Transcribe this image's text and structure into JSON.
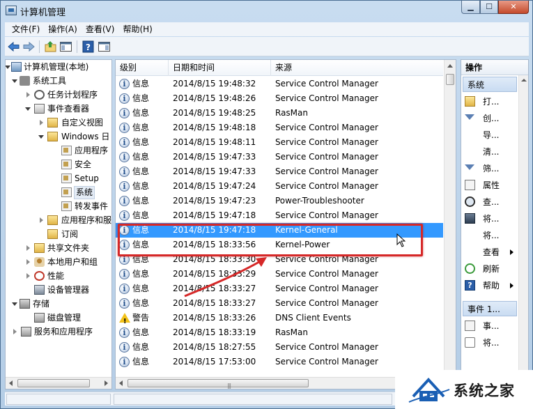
{
  "window": {
    "title": "计算机管理",
    "controls": {
      "minimize": "▁",
      "maximize": "☐",
      "close": "✕"
    }
  },
  "menu": [
    "文件(F)",
    "操作(A)",
    "查看(V)",
    "帮助(H)"
  ],
  "toolbar": {
    "icons": [
      "back-arrow-icon",
      "forward-arrow-icon",
      "up-folder-icon",
      "show-hide-tree-icon",
      "help-icon",
      "show-hide-action-pane-icon"
    ]
  },
  "tree": [
    {
      "label": "计算机管理(本地)",
      "level": 0,
      "expanded": true,
      "icon": "computer-management-icon"
    },
    {
      "label": "系统工具",
      "level": 1,
      "expanded": true,
      "icon": "system-tools-icon"
    },
    {
      "label": "任务计划程序",
      "level": 2,
      "expanded": false,
      "icon": "task-scheduler-icon"
    },
    {
      "label": "事件查看器",
      "level": 2,
      "expanded": true,
      "icon": "event-viewer-icon"
    },
    {
      "label": "自定义视图",
      "level": 3,
      "expanded": false,
      "icon": "folder-icon"
    },
    {
      "label": "Windows 日",
      "level": 3,
      "expanded": true,
      "icon": "folder-icon"
    },
    {
      "label": "应用程序",
      "level": 4,
      "icon": "log-icon"
    },
    {
      "label": "安全",
      "level": 4,
      "icon": "log-icon"
    },
    {
      "label": "Setup",
      "level": 4,
      "icon": "log-icon"
    },
    {
      "label": "系统",
      "level": 4,
      "icon": "log-icon",
      "selected": true
    },
    {
      "label": "转发事件",
      "level": 4,
      "icon": "log-icon"
    },
    {
      "label": "应用程序和服",
      "level": 3,
      "expanded": false,
      "icon": "folder-icon"
    },
    {
      "label": "订阅",
      "level": 3,
      "icon": "subscription-icon"
    },
    {
      "label": "共享文件夹",
      "level": 2,
      "expanded": false,
      "icon": "shared-folder-icon"
    },
    {
      "label": "本地用户和组",
      "level": 2,
      "expanded": false,
      "icon": "users-groups-icon"
    },
    {
      "label": "性能",
      "level": 2,
      "expanded": false,
      "icon": "performance-icon"
    },
    {
      "label": "设备管理器",
      "level": 2,
      "icon": "device-manager-icon"
    },
    {
      "label": "存储",
      "level": 1,
      "expanded": true,
      "icon": "storage-icon"
    },
    {
      "label": "磁盘管理",
      "level": 2,
      "icon": "disk-management-icon"
    },
    {
      "label": "服务和应用程序",
      "level": 1,
      "expanded": false,
      "icon": "services-apps-icon"
    }
  ],
  "events": {
    "columns": [
      "级别",
      "日期和时间",
      "来源"
    ],
    "rows": [
      {
        "level": "信息",
        "type": "info",
        "datetime": "2014/8/15 19:48:32",
        "source": "Service Control Manager"
      },
      {
        "level": "信息",
        "type": "info",
        "datetime": "2014/8/15 19:48:26",
        "source": "Service Control Manager"
      },
      {
        "level": "信息",
        "type": "info",
        "datetime": "2014/8/15 19:48:25",
        "source": "RasMan"
      },
      {
        "level": "信息",
        "type": "info",
        "datetime": "2014/8/15 19:48:18",
        "source": "Service Control Manager"
      },
      {
        "level": "信息",
        "type": "info",
        "datetime": "2014/8/15 19:48:11",
        "source": "Service Control Manager"
      },
      {
        "level": "信息",
        "type": "info",
        "datetime": "2014/8/15 19:47:33",
        "source": "Service Control Manager"
      },
      {
        "level": "信息",
        "type": "info",
        "datetime": "2014/8/15 19:47:33",
        "source": "Service Control Manager"
      },
      {
        "level": "信息",
        "type": "info",
        "datetime": "2014/8/15 19:47:24",
        "source": "Service Control Manager"
      },
      {
        "level": "信息",
        "type": "info",
        "datetime": "2014/8/15 19:47:23",
        "source": "Power-Troubleshooter"
      },
      {
        "level": "信息",
        "type": "info",
        "datetime": "2014/8/15 19:47:18",
        "source": "Service Control Manager"
      },
      {
        "level": "信息",
        "type": "info",
        "datetime": "2014/8/15 19:47:18",
        "source": "Kernel-General",
        "selected": true
      },
      {
        "level": "信息",
        "type": "info",
        "datetime": "2014/8/15 18:33:56",
        "source": "Kernel-Power",
        "highlighted": true
      },
      {
        "level": "信息",
        "type": "info",
        "datetime": "2014/8/15 18:33:30",
        "source": "Service Control Manager"
      },
      {
        "level": "信息",
        "type": "info",
        "datetime": "2014/8/15 18:33:29",
        "source": "Service Control Manager"
      },
      {
        "level": "信息",
        "type": "info",
        "datetime": "2014/8/15 18:33:27",
        "source": "Service Control Manager"
      },
      {
        "level": "信息",
        "type": "info",
        "datetime": "2014/8/15 18:33:27",
        "source": "Service Control Manager"
      },
      {
        "level": "警告",
        "type": "warning",
        "datetime": "2014/8/15 18:33:26",
        "source": "DNS Client Events"
      },
      {
        "level": "信息",
        "type": "info",
        "datetime": "2014/8/15 18:33:19",
        "source": "RasMan"
      },
      {
        "level": "信息",
        "type": "info",
        "datetime": "2014/8/15 18:27:55",
        "source": "Service Control Manager"
      },
      {
        "level": "信息",
        "type": "info",
        "datetime": "2014/8/15 17:53:00",
        "source": "Service Control Manager"
      }
    ]
  },
  "actions": {
    "title": "操作",
    "section1": "系统",
    "items1": [
      {
        "label": "打...",
        "icon": "open-log-icon"
      },
      {
        "label": "创...",
        "icon": "create-view-icon"
      },
      {
        "label": "导...",
        "icon": ""
      },
      {
        "label": "清...",
        "icon": ""
      },
      {
        "label": "筛...",
        "icon": "filter-icon"
      },
      {
        "label": "属性",
        "icon": "properties-icon"
      },
      {
        "label": "查...",
        "icon": "find-icon"
      },
      {
        "label": "将...",
        "icon": "save-icon"
      },
      {
        "label": "将...",
        "icon": ""
      },
      {
        "label": "查看",
        "icon": "",
        "submenu": true
      },
      {
        "label": "刷新",
        "icon": "refresh-icon"
      },
      {
        "label": "帮助",
        "icon": "help-icon",
        "submenu": true
      }
    ],
    "section2": "事件 1...",
    "items2": [
      {
        "label": "事...",
        "icon": "event-properties-icon"
      },
      {
        "label": "将...",
        "icon": "attach-task-icon"
      }
    ]
  },
  "watermark": {
    "text": "系统之家"
  },
  "colors": {
    "selection": "#3399ff",
    "annotation": "#d62828",
    "window_frame": "#b4cde6"
  }
}
